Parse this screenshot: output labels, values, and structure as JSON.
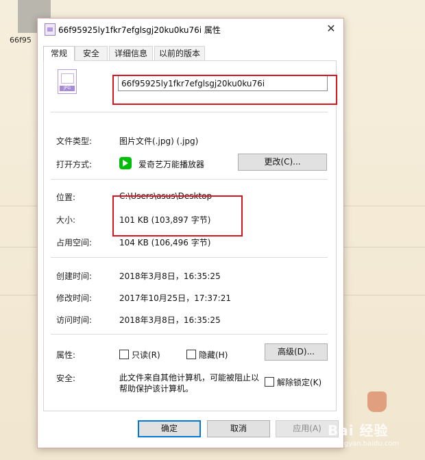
{
  "desktop": {
    "icon_label": "66f95"
  },
  "window": {
    "title": "66f95925ly1fkr7efglsgj20ku0ku76i 属性",
    "close_glyph": "✕"
  },
  "tabs": [
    {
      "label": "常规",
      "active": true
    },
    {
      "label": "安全",
      "active": false
    },
    {
      "label": "详细信息",
      "active": false
    },
    {
      "label": "以前的版本",
      "active": false
    }
  ],
  "file": {
    "icon_badge": "JPG",
    "name": "66f95925ly1fkr7efglsgj20ku0ku76i"
  },
  "rows": {
    "type_label": "文件类型:",
    "type_value": "图片文件(.jpg) (.jpg)",
    "open_label": "打开方式:",
    "open_value": "爱奇艺万能播放器",
    "change_button": "更改(C)...",
    "location_label": "位置:",
    "location_value": "C:\\Users\\asus\\Desktop",
    "size_label": "大小:",
    "size_value": "101 KB (103,897 字节)",
    "disk_label": "占用空间:",
    "disk_value": "104 KB (106,496 字节)",
    "created_label": "创建时间:",
    "created_value": "2018年3月8日，16:35:25",
    "modified_label": "修改时间:",
    "modified_value": "2017年10月25日，17:37:21",
    "accessed_label": "访问时间:",
    "accessed_value": "2018年3月8日，16:35:25"
  },
  "attributes": {
    "label": "属性:",
    "readonly": "只读(R)",
    "hidden": "隐藏(H)",
    "advanced_button": "高级(D)...",
    "readonly_checked": false,
    "hidden_checked": false
  },
  "security": {
    "label": "安全:",
    "text": "此文件来自其他计算机，可能被阻止以帮助保护该计算机。",
    "unblock": "解除锁定(K)",
    "unblock_checked": false
  },
  "footer": {
    "ok": "确定",
    "cancel": "取消",
    "apply": "应用(A)"
  },
  "watermark": {
    "text": "Bai 经验",
    "sub": "jingyan.baidu.com"
  },
  "colors": {
    "highlight_box": "#d7141f",
    "accent": "#0078d7"
  }
}
